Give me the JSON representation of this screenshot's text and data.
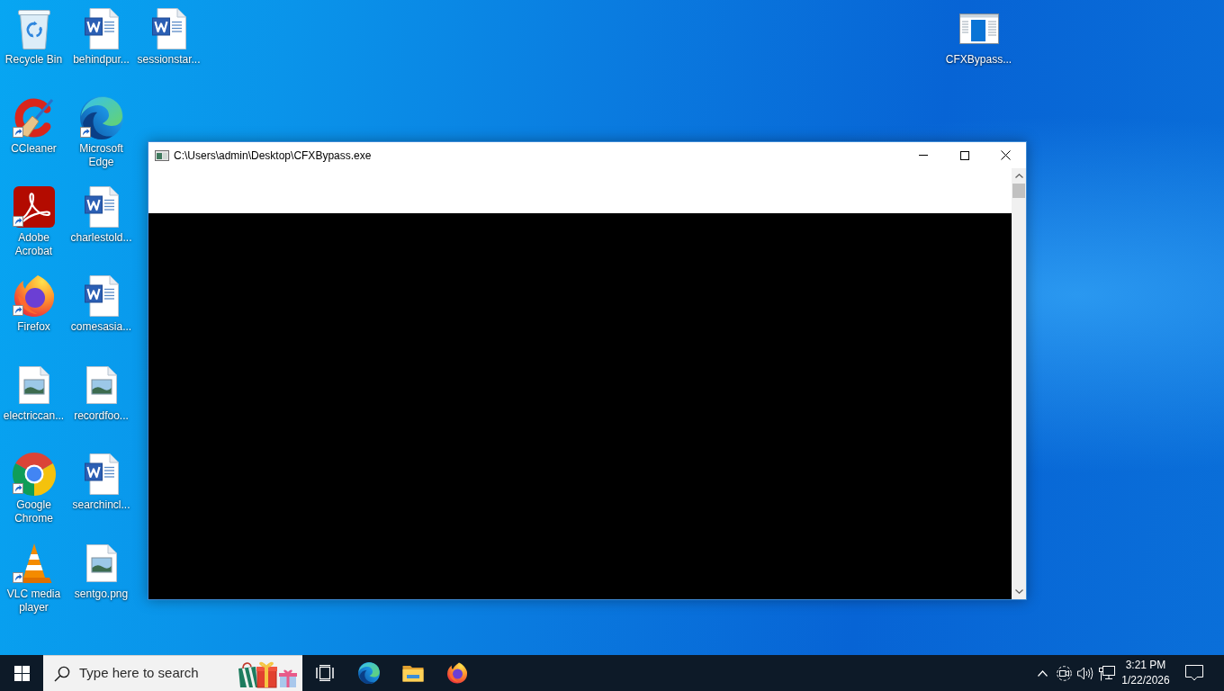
{
  "desktop": {
    "icon_rows": [
      [
        {
          "label": "Recycle Bin",
          "kind": "recycle-bin",
          "shortcut": false
        },
        {
          "label": "behindpur...",
          "kind": "word",
          "shortcut": false
        },
        {
          "label": "sessionstar...",
          "kind": "word",
          "shortcut": false
        }
      ],
      [
        {
          "label": "CCleaner",
          "kind": "ccleaner",
          "shortcut": true
        },
        {
          "label": "Microsoft Edge",
          "kind": "edge",
          "shortcut": true
        }
      ],
      [
        {
          "label": "Adobe Acrobat",
          "kind": "acrobat",
          "shortcut": true
        },
        {
          "label": "charlestold...",
          "kind": "word",
          "shortcut": false
        }
      ],
      [
        {
          "label": "Firefox",
          "kind": "firefox",
          "shortcut": true
        },
        {
          "label": "comesasia...",
          "kind": "word",
          "shortcut": false
        }
      ],
      [
        {
          "label": "electriccan...",
          "kind": "image",
          "shortcut": false
        },
        {
          "label": "recordfoo...",
          "kind": "image",
          "shortcut": false
        }
      ],
      [
        {
          "label": "Google Chrome",
          "kind": "chrome",
          "shortcut": true
        },
        {
          "label": "searchincl...",
          "kind": "word",
          "shortcut": false
        }
      ],
      [
        {
          "label": "VLC media player",
          "kind": "vlc",
          "shortcut": true
        },
        {
          "label": "sentgo.png",
          "kind": "image",
          "shortcut": false
        }
      ]
    ],
    "corner_icons": [
      {
        "label": "CFXBypass...",
        "kind": "program",
        "shortcut": false
      }
    ]
  },
  "window": {
    "title": "C:\\Users\\admin\\Desktop\\CFXBypass.exe"
  },
  "taskbar": {
    "search": {
      "placeholder": "Type here to search"
    },
    "clock": {
      "time": "3:21 PM",
      "date": "1/22/2026"
    }
  }
}
